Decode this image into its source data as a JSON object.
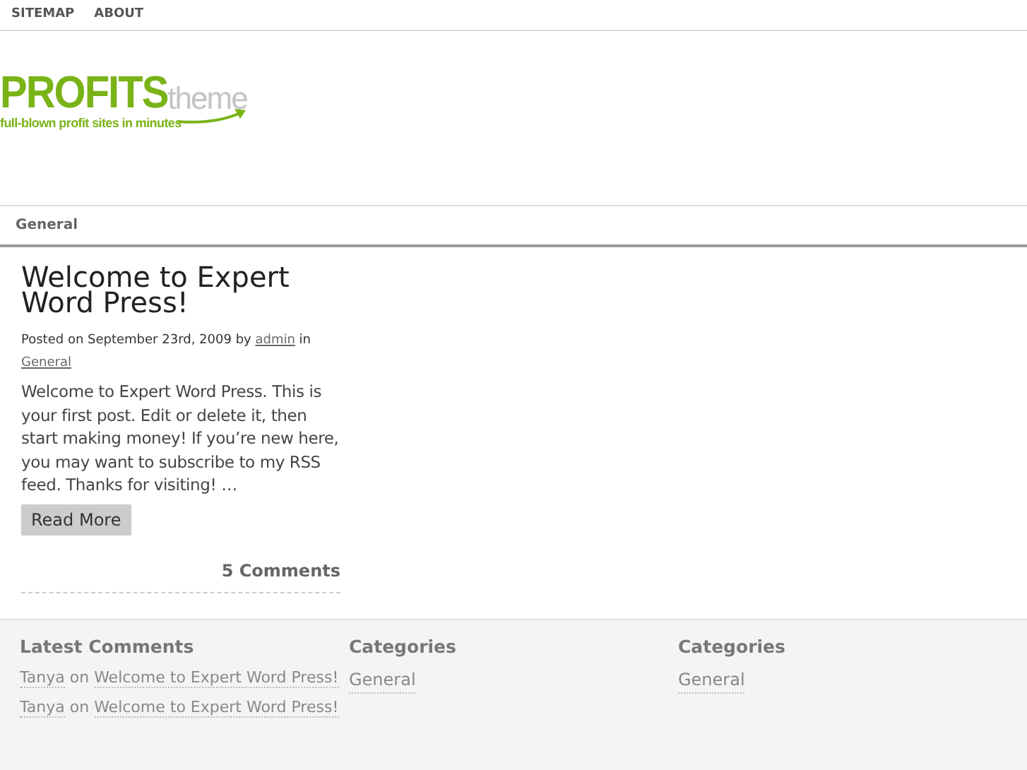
{
  "top_nav": [
    "SITEMAP",
    "ABOUT"
  ],
  "logo": {
    "main": "PROFITS",
    "sub": "theme",
    "tagline": "full-blown profit sites in minutes"
  },
  "category_nav": [
    "General"
  ],
  "post": {
    "title": "Welcome to Expert Word Press!",
    "meta_prefix": "Posted on September 23rd, 2009 by",
    "author": "admin",
    "meta_in": "in",
    "category": "General",
    "excerpt": "Welcome to Expert Word Press. This is your first post. Edit or delete it, then start making money! If you’re new here, you may want to subscribe to my RSS feed. Thanks for visiting! …",
    "read_more": "Read More",
    "comments": "5 Comments"
  },
  "footer": [
    {
      "title": "Latest Comments",
      "kind": "comments",
      "items": [
        {
          "author": "Tanya",
          "on": "on",
          "post": "Welcome to Expert Word Press!"
        },
        {
          "author": "Tanya",
          "on": "on",
          "post": "Welcome to Expert Word Press!"
        }
      ]
    },
    {
      "title": "Categories",
      "kind": "links",
      "items": [
        {
          "label": "General"
        }
      ]
    },
    {
      "title": "Categories",
      "kind": "links",
      "items": [
        {
          "label": "General"
        }
      ]
    }
  ]
}
